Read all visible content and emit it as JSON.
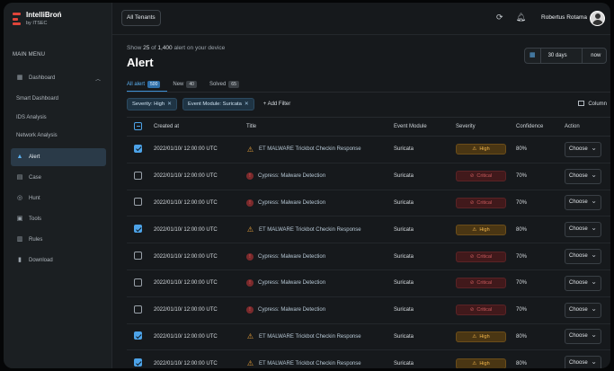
{
  "app": {
    "name": "IntelliBroń",
    "subtitle": "by ITSEC"
  },
  "sidebar": {
    "menu_heading": "MAIN MENU",
    "items": [
      {
        "label": "Dashboard",
        "icon": "dashboard-icon",
        "expanded": true
      },
      {
        "label": "Smart Dashboard",
        "sub": true
      },
      {
        "label": "IDS Analysis",
        "sub": true
      },
      {
        "label": "Network Analysis",
        "sub": true
      },
      {
        "label": "Alert",
        "icon": "alert-icon",
        "active": true
      },
      {
        "label": "Case",
        "icon": "case-icon"
      },
      {
        "label": "Hunt",
        "icon": "hunt-icon"
      },
      {
        "label": "Tools",
        "icon": "tools-icon"
      },
      {
        "label": "Rules",
        "icon": "rules-icon"
      },
      {
        "label": "Download",
        "icon": "download-icon"
      }
    ]
  },
  "topbar": {
    "tenant_button": "All Tenants",
    "user_name": "Robertus Rotama"
  },
  "header": {
    "show_prefix": "Show",
    "show_count": "25",
    "show_of": "of",
    "show_total": "1,400",
    "show_suffix": "alert on your device",
    "title": "Alert",
    "range_value": "30 days",
    "range_now": "now"
  },
  "tabs": [
    {
      "label": "All alert",
      "count": "500",
      "active": true
    },
    {
      "label": "New",
      "count": "40"
    },
    {
      "label": "Solved",
      "count": "65"
    }
  ],
  "filters": {
    "chips": [
      "Severity: High",
      "Event Module: Suricata"
    ],
    "add_label": "+ Add Filter",
    "column_label": "Column"
  },
  "table": {
    "headers": [
      "Created at",
      "Title",
      "Event Module",
      "Severity",
      "Confidence",
      "Action"
    ],
    "rows": [
      {
        "checked": true,
        "created": "2022/01/10/ 12:00:00 UTC",
        "title": "ET MALWARE Trickbot Checkin Response",
        "title_icon": "warning",
        "module": "Suricata",
        "severity": "High",
        "confidence": "80%",
        "action": "Choose"
      },
      {
        "checked": false,
        "created": "2022/01/10/ 12:00:00 UTC",
        "title": "Cypress: Malware Detection",
        "title_icon": "critical",
        "module": "Suricata",
        "severity": "Critical",
        "confidence": "70%",
        "action": "Choose"
      },
      {
        "checked": false,
        "created": "2022/01/10/ 12:00:00 UTC",
        "title": "Cypress: Malware Detection",
        "title_icon": "critical",
        "module": "Suricata",
        "severity": "Critical",
        "confidence": "70%",
        "action": "Choose"
      },
      {
        "checked": true,
        "created": "2022/01/10/ 12:00:00 UTC",
        "title": "ET MALWARE Trickbot Checkin Response",
        "title_icon": "warning",
        "module": "Suricata",
        "severity": "High",
        "confidence": "80%",
        "action": "Choose"
      },
      {
        "checked": false,
        "created": "2022/01/10/ 12:00:00 UTC",
        "title": "Cypress: Malware Detection",
        "title_icon": "critical",
        "module": "Suricata",
        "severity": "Critical",
        "confidence": "70%",
        "action": "Choose"
      },
      {
        "checked": false,
        "created": "2022/01/10/ 12:00:00 UTC",
        "title": "Cypress: Malware Detection",
        "title_icon": "critical",
        "module": "Suricata",
        "severity": "Critical",
        "confidence": "70%",
        "action": "Choose"
      },
      {
        "checked": false,
        "created": "2022/01/10/ 12:00:00 UTC",
        "title": "Cypress: Malware Detection",
        "title_icon": "critical",
        "module": "Suricata",
        "severity": "Critical",
        "confidence": "70%",
        "action": "Choose"
      },
      {
        "checked": true,
        "created": "2022/01/10/ 12:00:00 UTC",
        "title": "ET MALWARE Trickbot Checkin Response",
        "title_icon": "warning",
        "module": "Suricata",
        "severity": "High",
        "confidence": "80%",
        "action": "Choose"
      },
      {
        "checked": true,
        "created": "2022/01/10/ 12:00:00 UTC",
        "title": "ET MALWARE Trickbot Checkin Response",
        "title_icon": "warning",
        "module": "Suricata",
        "severity": "High",
        "confidence": "80%",
        "action": "Choose"
      }
    ]
  },
  "colors": {
    "accent": "#4da3e8",
    "high": "#f0b44a",
    "critical": "#c95a5c",
    "logo": "#e0453a"
  }
}
